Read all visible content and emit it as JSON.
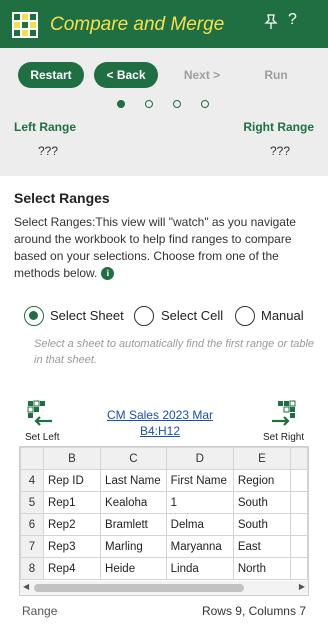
{
  "header": {
    "title": "Compare and Merge",
    "pin_icon": "pin-icon",
    "help_label": "?"
  },
  "toolbar": {
    "restart": "Restart",
    "back": "< Back",
    "next": "Next >",
    "run": "Run"
  },
  "steps": {
    "total": 4,
    "current": 1
  },
  "ranges": {
    "left_label": "Left Range",
    "right_label": "Right Range",
    "left_value": "???",
    "right_value": "???"
  },
  "section": {
    "title": "Select Ranges",
    "description": "Select Ranges:This view will \"watch\" as you navigate around the workbook to help find ranges to compare based on your selections. Choose from one of the methods below."
  },
  "options": [
    {
      "label": "Select Sheet",
      "checked": true
    },
    {
      "label": "Select Cell",
      "checked": false
    },
    {
      "label": "Manual",
      "checked": false
    }
  ],
  "hint": "Select a sheet to automatically find the first range or table in that sheet.",
  "set_left": "Set Left",
  "set_right": "Set Right",
  "link": {
    "line1": "CM Sales 2023 Mar",
    "line2": "B4:H12"
  },
  "grid": {
    "columns": [
      "B",
      "C",
      "D",
      "E"
    ],
    "rows": [
      {
        "num": "4",
        "cells": [
          "Rep ID",
          "Last Name",
          "First Name",
          "Region"
        ]
      },
      {
        "num": "5",
        "cells": [
          "Rep1",
          "Kealoha",
          "1",
          "South"
        ]
      },
      {
        "num": "6",
        "cells": [
          "Rep2",
          "Bramlett",
          "Delma",
          "South"
        ]
      },
      {
        "num": "7",
        "cells": [
          "Rep3",
          "Marling",
          "Maryanna",
          "East"
        ]
      },
      {
        "num": "8",
        "cells": [
          "Rep4",
          "Heide",
          "Linda",
          "North"
        ]
      }
    ]
  },
  "footer": {
    "left": "Range",
    "right": "Rows 9, Columns 7"
  },
  "colors": {
    "brand": "#1f6f43",
    "title": "#f4e04d",
    "link": "#1a4fb5"
  }
}
